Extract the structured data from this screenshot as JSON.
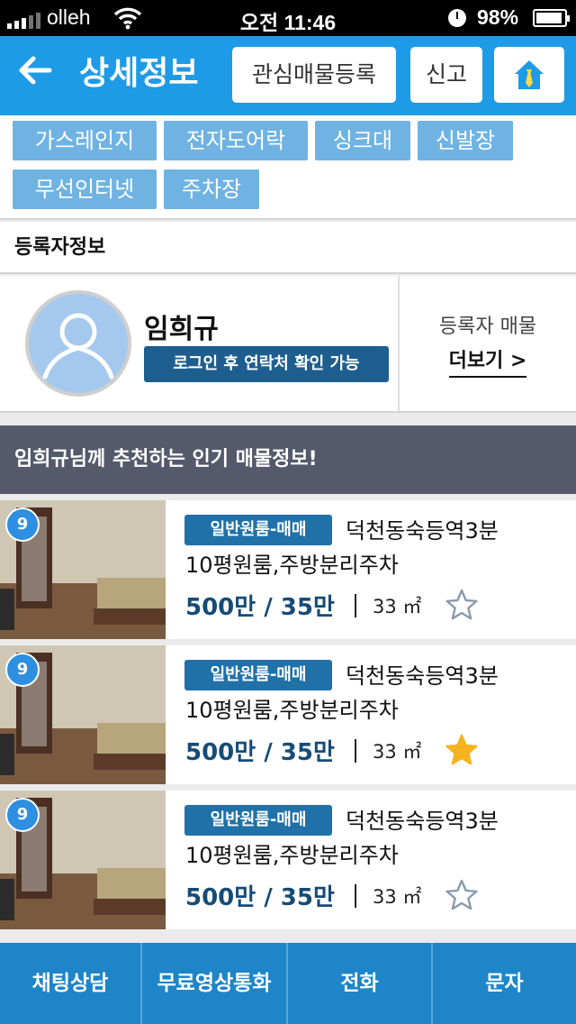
{
  "status_bar": {
    "carrier": "olleh",
    "time": "오전 11:46",
    "battery": "98%"
  },
  "header": {
    "title": "상세정보",
    "fav_button": "관심매물등록",
    "report_button": "신고"
  },
  "options": [
    "가스레인지",
    "전자도어락",
    "싱크대",
    "신발장",
    "무선인터넷",
    "주차장"
  ],
  "registrant": {
    "section_title": "등록자정보",
    "name": "임희규",
    "login_notice": "로그인 후 연락처 확인 가능",
    "more_label": "등록자 매물",
    "more_link": "더보기 >"
  },
  "recommend": {
    "title": "임희규님께 추천하는 인기 매물정보!",
    "listings": [
      {
        "badge": "9",
        "type": "일반원룸-매매",
        "title_line1": "덕천동숙등역3분",
        "title_line2": "10평원룸,주방분리주차",
        "price": "500만 / 35만",
        "area": "33 ㎡",
        "favorited": false
      },
      {
        "badge": "9",
        "type": "일반원룸-매매",
        "title_line1": "덕천동숙등역3분",
        "title_line2": "10평원룸,주방분리주차",
        "price": "500만 / 35만",
        "area": "33 ㎡",
        "favorited": true
      },
      {
        "badge": "9",
        "type": "일반원룸-매매",
        "title_line1": "덕천동숙등역3분",
        "title_line2": "10평원룸,주방분리주차",
        "price": "500만 / 35만",
        "area": "33 ㎡",
        "favorited": false
      }
    ]
  },
  "bottom_bar": [
    "채팅상담",
    "무료영상통화",
    "전화",
    "문자"
  ],
  "colors": {
    "header": "#1e9be6",
    "tag": "#6fb3e3",
    "badge": "#2071a8",
    "price": "#164b77",
    "bottom_bar": "#1e85c8",
    "star_active": "#f5b41e"
  }
}
